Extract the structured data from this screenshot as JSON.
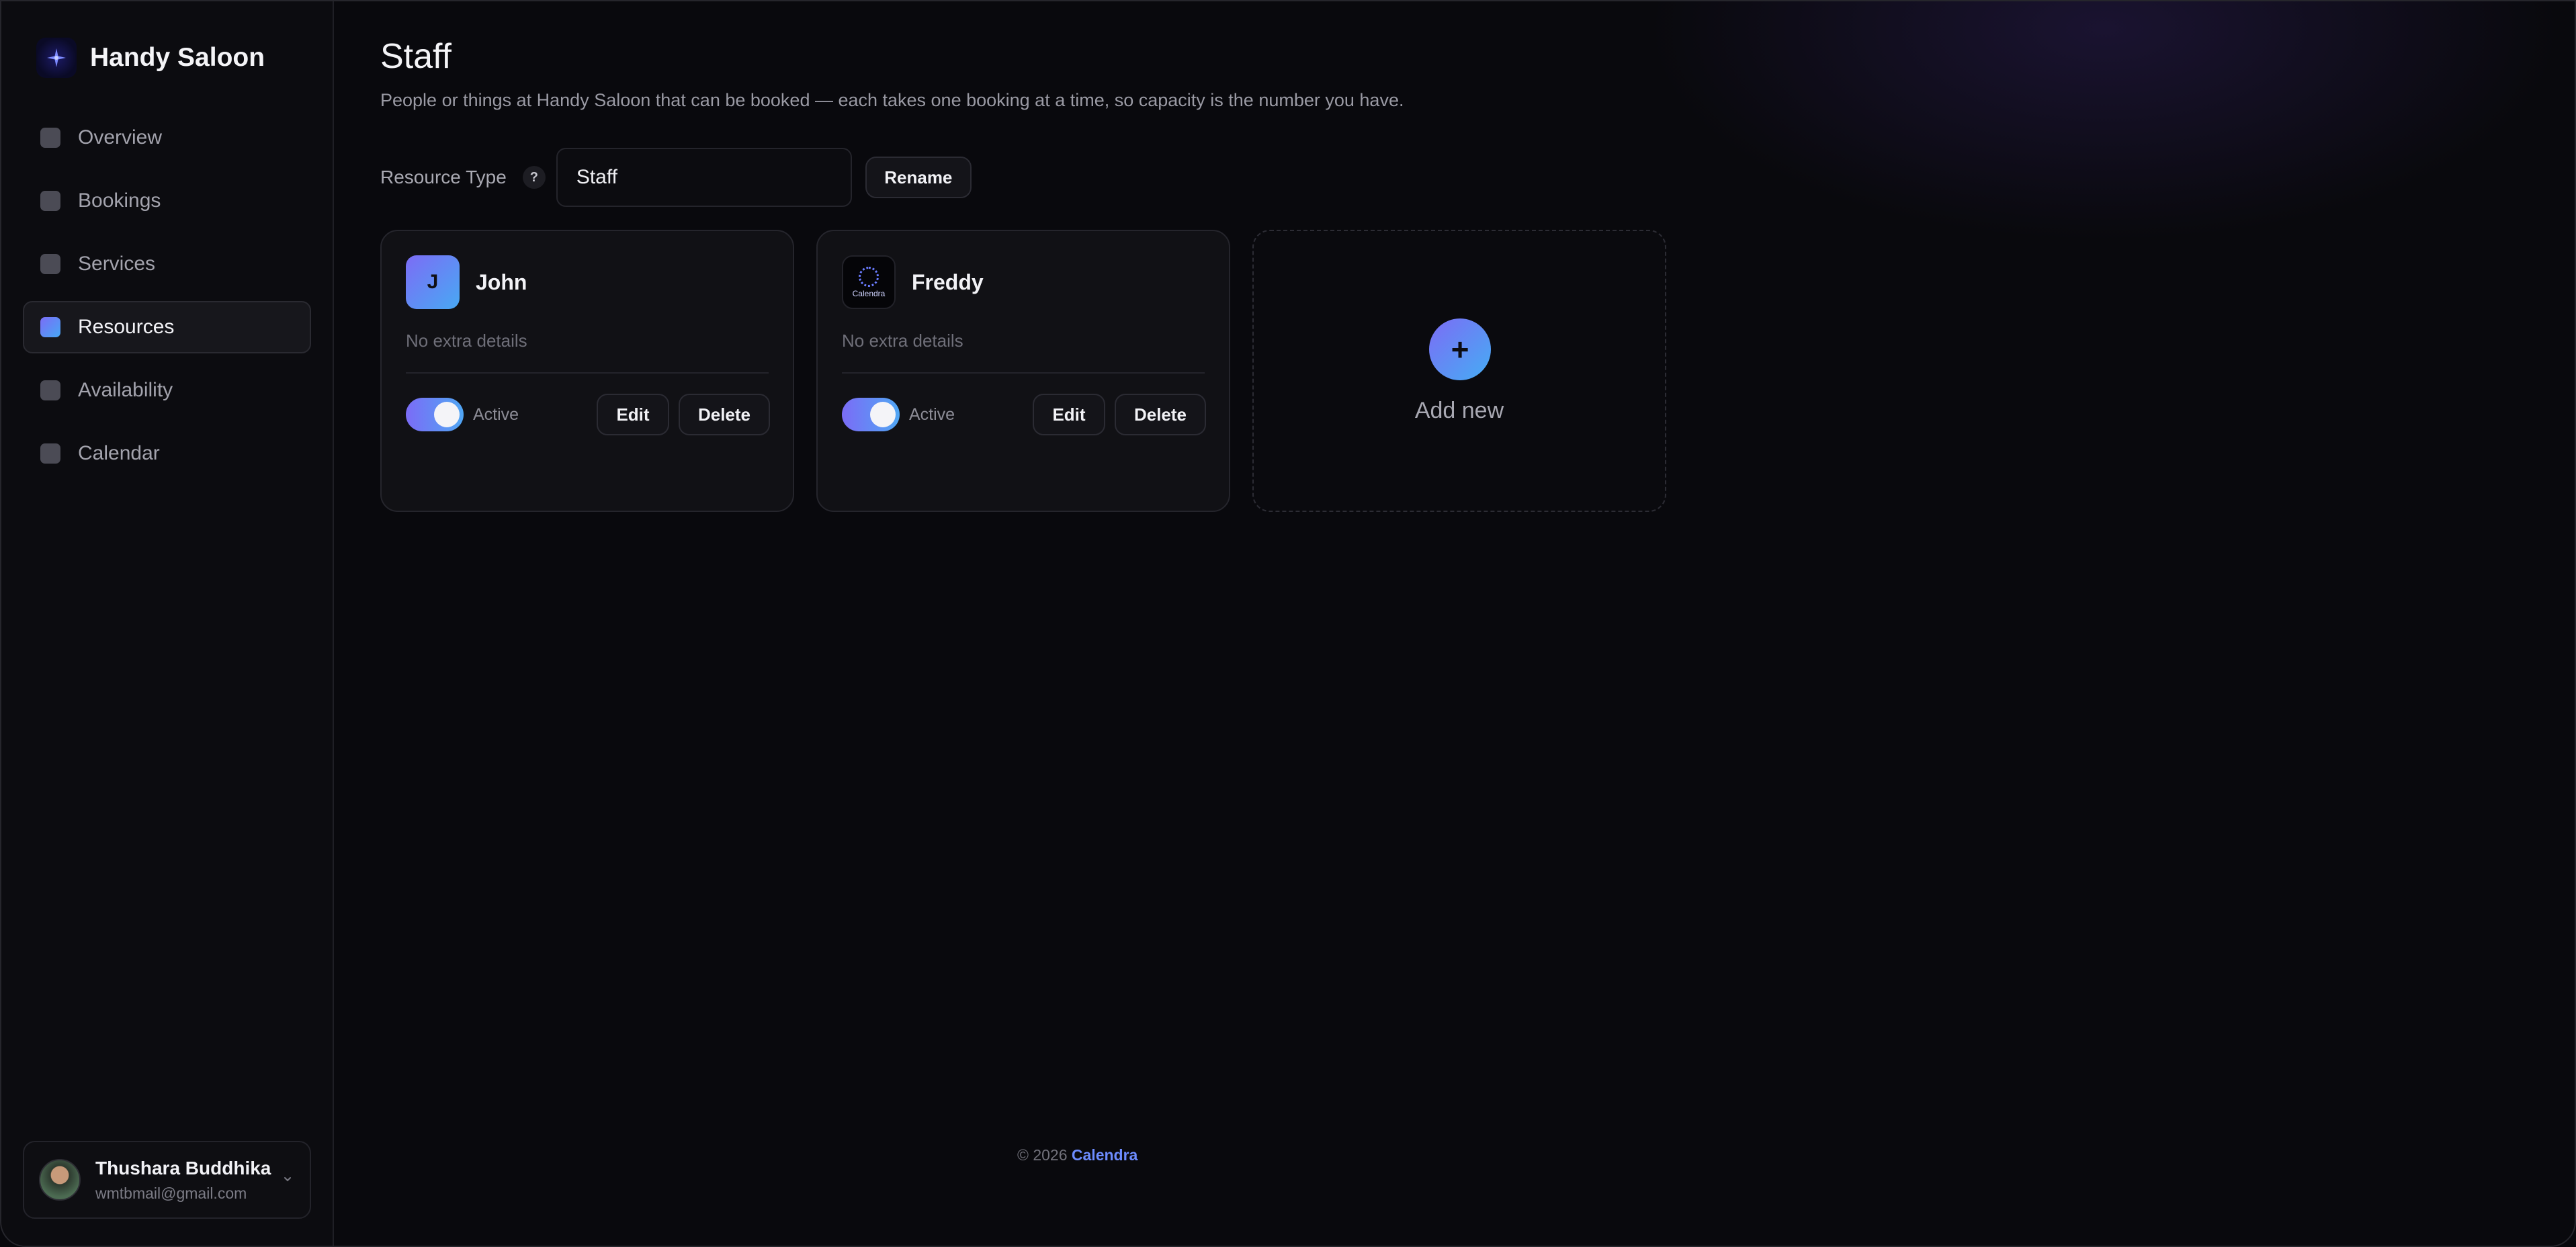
{
  "brand": {
    "name": "Handy Saloon"
  },
  "sidebar": {
    "items": [
      {
        "label": "Overview",
        "active": false
      },
      {
        "label": "Bookings",
        "active": false
      },
      {
        "label": "Services",
        "active": false
      },
      {
        "label": "Resources",
        "active": true
      },
      {
        "label": "Availability",
        "active": false
      },
      {
        "label": "Calendar",
        "active": false
      }
    ]
  },
  "user": {
    "name": "Thushara Buddhika",
    "email": "wmtbmail@gmail.com"
  },
  "page": {
    "title": "Staff",
    "description": "People or things at Handy Saloon that can be booked — each takes one booking at a time, so capacity is the number you have."
  },
  "resource_type": {
    "label": "Resource Type",
    "help": "?",
    "value": "Staff",
    "rename_label": "Rename"
  },
  "resources": [
    {
      "initial": "J",
      "name": "John",
      "details": "No extra details",
      "status_label": "Active",
      "active": true,
      "edit_label": "Edit",
      "delete_label": "Delete"
    },
    {
      "logo_text": "Calendra",
      "name": "Freddy",
      "details": "No extra details",
      "status_label": "Active",
      "active": true,
      "edit_label": "Edit",
      "delete_label": "Delete"
    }
  ],
  "add_new": {
    "icon": "+",
    "label": "Add new"
  },
  "footer": {
    "copyright": "© 2026",
    "brand": "Calendra"
  },
  "colors": {
    "accent_start": "#7b6cf6",
    "accent_end": "#46a8f5",
    "link": "#6d8cff"
  }
}
